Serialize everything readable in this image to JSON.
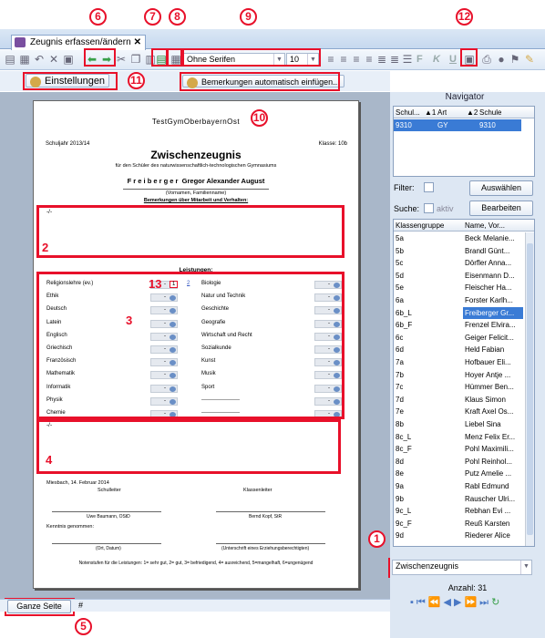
{
  "tab": {
    "title": "Zeugnis erfassen/ändern",
    "close": "✕"
  },
  "toolbar": {
    "font": "Ohne Serifen",
    "size": "10",
    "bold": "F",
    "italic": "K",
    "underline": "U"
  },
  "toolbar2": {
    "settings": "Einstellungen",
    "auto_remarks": "Bemerkungen automatisch einfügen..."
  },
  "callouts": {
    "c1": "1",
    "c5": "5",
    "c6": "6",
    "c7": "7",
    "c8": "8",
    "c9": "9",
    "c10": "10",
    "c11": "11",
    "c12": "12"
  },
  "box_labels": {
    "b2": "2",
    "b3": "3",
    "b4": "4",
    "b13": "13"
  },
  "doc": {
    "school": "TestGymOberbayernOst",
    "year": "Schuljahr 2013/14",
    "klasse": "Klasse: 10b",
    "title": "Zwischenzeugnis",
    "subtitle": "für den Schüler des naturwissenschaftlich-technologischen Gymnasiums",
    "student_last": "F r e i b e r g e r",
    "student_first": "Gregor Alexander August",
    "name_caption": "(Vornamen, Familienname)",
    "remarks_heading": "Bemerkungen über Mitarbeit und Verhalten:",
    "dash1": "-/-",
    "leistungen": "Leistungen:",
    "dash2": "-/-",
    "place_date": "Miesbach, 14. Februar 2014",
    "schulleiter": "Schulleiter",
    "klassenleiter": "Klassenleiter",
    "schulleiter_name": "Uwe Baumann, OStD",
    "klassenleiter_name": "Bernd Kopf, StR",
    "kenntnis": "Kenntnis genommen:",
    "ort_datum": "(Ort, Datum)",
    "unterschrift": "(Unterschrift eines Erziehungsberechtigten)",
    "footer": "Notenstufen für die Leistungen: 1= sehr gut, 2= gut, 3= befriedigend, 4= ausreichend, 5=mangelhaft, 6=ungenügend",
    "grade_placeholder": "-",
    "grade_13": "1",
    "grade_13b": "2",
    "left_subjects": [
      "Religionslehre (ev.)",
      "Ethik",
      "Deutsch",
      "Latein",
      "Englisch",
      "Griechisch",
      "Französisch",
      "Mathematik",
      "Informatik",
      "Physik",
      "Chemie"
    ],
    "right_subjects": [
      "Biologie",
      "Natur und Technik",
      "Geschichte",
      "Geografie",
      "Wirtschaft und Recht",
      "Sozialkunde",
      "Kunst",
      "Musik",
      "Sport",
      "---------------------",
      "---------------------"
    ]
  },
  "navigator": {
    "title": "Navigator",
    "cols": [
      "Schul...",
      "Art",
      "Schule"
    ],
    "sort1": "▲1",
    "sort2": "▲2",
    "row": [
      "9310",
      "GY",
      "9310"
    ],
    "filter_label": "Filter:",
    "auswaehlen": "Auswählen",
    "suche_label": "Suche:",
    "aktiv": "aktiv",
    "bearbeiten": "Bearbeiten",
    "list_cols": [
      "Klassengruppe",
      "Name, Vor..."
    ],
    "klassen": [
      "5a",
      "5b",
      "5c",
      "5d",
      "5e",
      "6a",
      "6b_L",
      "6b_F",
      "6c",
      "6d",
      "7a",
      "7b",
      "7c",
      "7d",
      "7e",
      "8b",
      "8c_L",
      "8c_F",
      "8d",
      "8e",
      "9a",
      "9b",
      "9c_L",
      "9c_F",
      "9d"
    ],
    "namen": [
      "Beck Melanie...",
      "Brandl Günt...",
      "Dörfler Anna...",
      "Eisenmann D...",
      "Fleischer Ha...",
      "Forster Karlh...",
      "Freiberger Gr...",
      "Frenzel Elvira...",
      "Geiger Felicit...",
      "Held Fabian",
      "Hofbauer Eli...",
      "Hoyer Antje ...",
      "Hümmer Ben...",
      "Klaus Simon",
      "Kraft Axel Os...",
      "Liebel Sina",
      "Menz Felix Er...",
      "Pohl Maximili...",
      "Pohl Reinhol...",
      "Putz Amelie ...",
      "Rabl Edmund",
      "Rauscher Ulri...",
      "Rebhan Evi ...",
      "Reuß Karsten",
      "Riederer Alice"
    ],
    "selected_index": 6,
    "zeugnis_select": "Zwischenzeugnis",
    "anzahl": "Anzahl: 31"
  },
  "statusbar": {
    "zoom": "Ganze Seite",
    "hash": "#"
  },
  "colors": {
    "highlight": "#e8102a",
    "selection": "#3a7bd5"
  }
}
